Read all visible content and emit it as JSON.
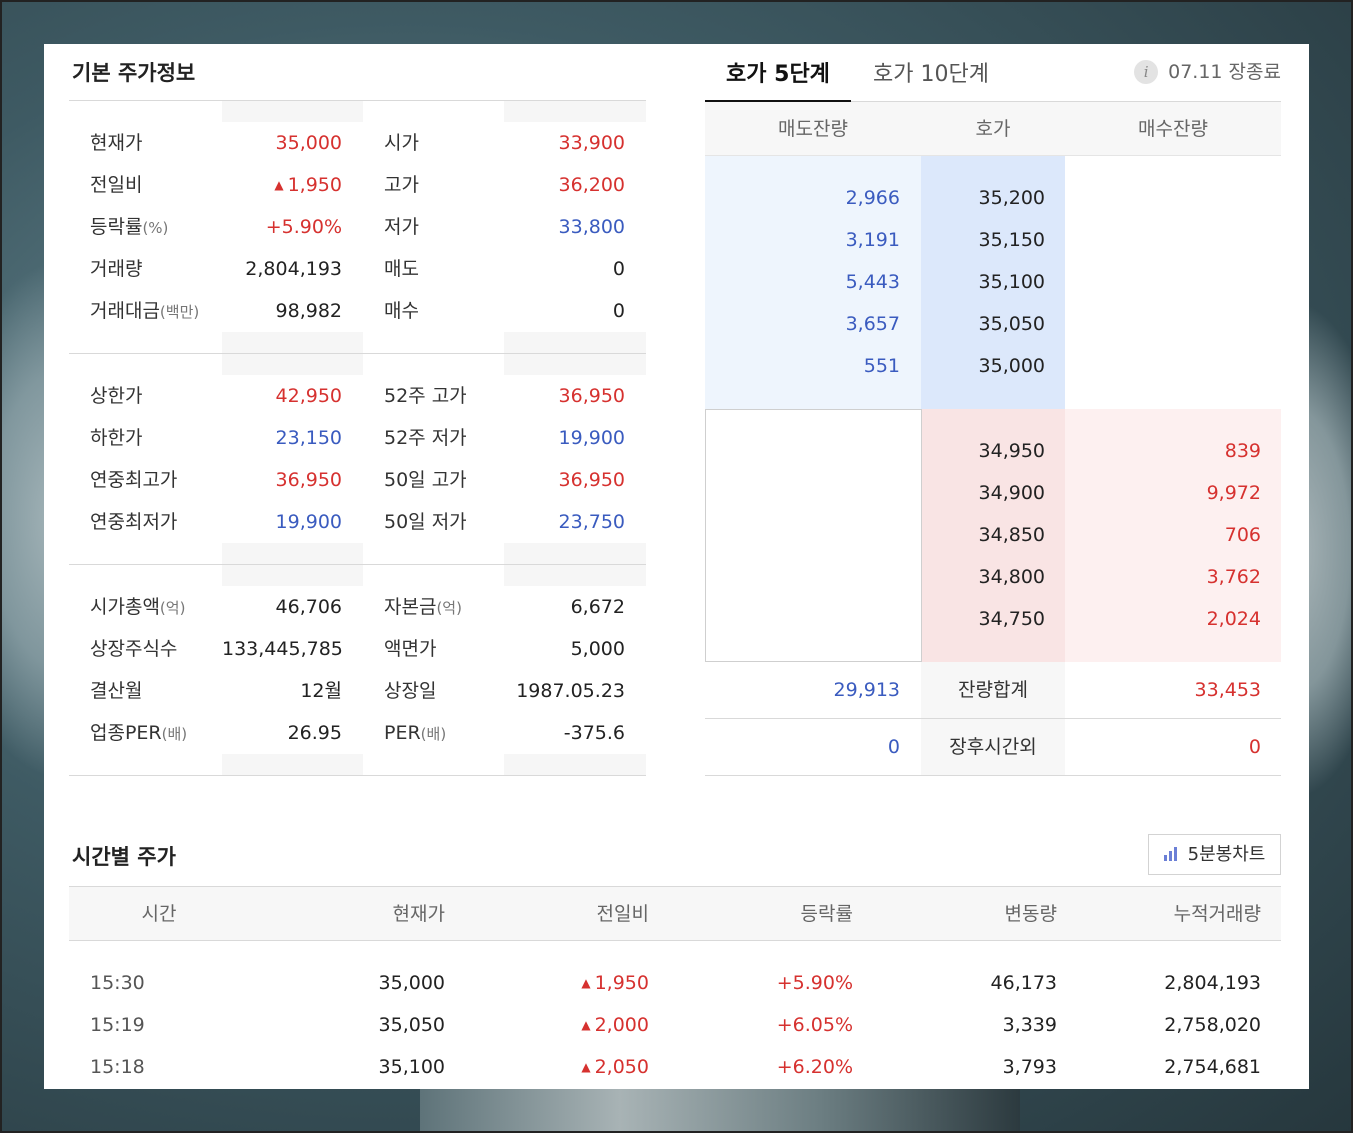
{
  "basic": {
    "title": "기본 주가정보",
    "block1": [
      {
        "l1": "현재가",
        "l1s": "",
        "v1": "35,000",
        "v1c": "red",
        "l2": "시가",
        "l2s": "",
        "v2": "33,900",
        "v2c": "red"
      },
      {
        "l1": "전일비",
        "l1s": "",
        "v1": "1,950",
        "v1c": "red",
        "l2": "고가",
        "l2s": "",
        "v2": "36,200",
        "v2c": "red"
      },
      {
        "l1": "등락률",
        "l1s": "(%)",
        "v1": "+5.90%",
        "v1c": "red",
        "l2": "저가",
        "l2s": "",
        "v2": "33,800",
        "v2c": "blue"
      },
      {
        "l1": "거래량",
        "l1s": "",
        "v1": "2,804,193",
        "v1c": "",
        "l2": "매도",
        "l2s": "",
        "v2": "0",
        "v2c": ""
      },
      {
        "l1": "거래대금",
        "l1s": "(백만)",
        "v1": "98,982",
        "v1c": "",
        "l2": "매수",
        "l2s": "",
        "v2": "0",
        "v2c": ""
      }
    ],
    "block2": [
      {
        "l1": "상한가",
        "l1s": "",
        "v1": "42,950",
        "v1c": "red",
        "l2": "52주 고가",
        "l2s": "",
        "v2": "36,950",
        "v2c": "red"
      },
      {
        "l1": "하한가",
        "l1s": "",
        "v1": "23,150",
        "v1c": "blue",
        "l2": "52주 저가",
        "l2s": "",
        "v2": "19,900",
        "v2c": "blue"
      },
      {
        "l1": "연중최고가",
        "l1s": "",
        "v1": "36,950",
        "v1c": "red",
        "l2": "50일 고가",
        "l2s": "",
        "v2": "36,950",
        "v2c": "red"
      },
      {
        "l1": "연중최저가",
        "l1s": "",
        "v1": "19,900",
        "v1c": "blue",
        "l2": "50일 저가",
        "l2s": "",
        "v2": "23,750",
        "v2c": "blue"
      }
    ],
    "block3": [
      {
        "l1": "시가총액",
        "l1s": "(억)",
        "v1": "46,706",
        "v1c": "",
        "l2": "자본금",
        "l2s": "(억)",
        "v2": "6,672",
        "v2c": ""
      },
      {
        "l1": "상장주식수",
        "l1s": "",
        "v1": "133,445,785",
        "v1c": "",
        "l2": "액면가",
        "l2s": "",
        "v2": "5,000",
        "v2c": ""
      },
      {
        "l1": "결산월",
        "l1s": "",
        "v1": "12월",
        "v1c": "",
        "l2": "상장일",
        "l2s": "",
        "v2": "1987.05.23",
        "v2c": ""
      },
      {
        "l1": "업종PER",
        "l1s": "(배)",
        "v1": "26.95",
        "v1c": "",
        "l2": "PER",
        "l2s": "(배)",
        "v2": "-375.6",
        "v2c": ""
      }
    ]
  },
  "orderbook": {
    "tab1": "호가 5단계",
    "tab2": "호가 10단계",
    "info_icon": "i",
    "status": "07.11 장종료",
    "head": {
      "sell": "매도잔량",
      "price": "호가",
      "buy": "매수잔량"
    },
    "asks": [
      {
        "qty": "2,966",
        "price": "35,200"
      },
      {
        "qty": "3,191",
        "price": "35,150"
      },
      {
        "qty": "5,443",
        "price": "35,100"
      },
      {
        "qty": "3,657",
        "price": "35,050"
      },
      {
        "qty": "551",
        "price": "35,000"
      }
    ],
    "bids": [
      {
        "price": "34,950",
        "qty": "839"
      },
      {
        "price": "34,900",
        "qty": "9,972"
      },
      {
        "price": "34,850",
        "qty": "706"
      },
      {
        "price": "34,800",
        "qty": "3,762"
      },
      {
        "price": "34,750",
        "qty": "2,024"
      }
    ],
    "total": {
      "sell": "29,913",
      "label": "잔량합계",
      "buy": "33,453"
    },
    "after": {
      "sell": "0",
      "label": "장후시간외",
      "buy": "0"
    }
  },
  "timeprice": {
    "title": "시간별 주가",
    "chart_button": "5분봉차트",
    "columns": [
      "시간",
      "현재가",
      "전일비",
      "등락률",
      "변동량",
      "누적거래량"
    ],
    "rows": [
      {
        "time": "15:30",
        "price": "35,000",
        "change": "1,950",
        "rate": "+5.90%",
        "vol": "46,173",
        "cum": "2,804,193"
      },
      {
        "time": "15:19",
        "price": "35,050",
        "change": "2,000",
        "rate": "+6.05%",
        "vol": "3,339",
        "cum": "2,758,020"
      },
      {
        "time": "15:18",
        "price": "35,100",
        "change": "2,050",
        "rate": "+6.20%",
        "vol": "3,793",
        "cum": "2,754,681"
      }
    ]
  },
  "colors": {
    "up": "#d6312f",
    "down": "#3a5bbf",
    "ask_bg": "#eef5fd",
    "bid_bg": "#fdf0f0"
  }
}
